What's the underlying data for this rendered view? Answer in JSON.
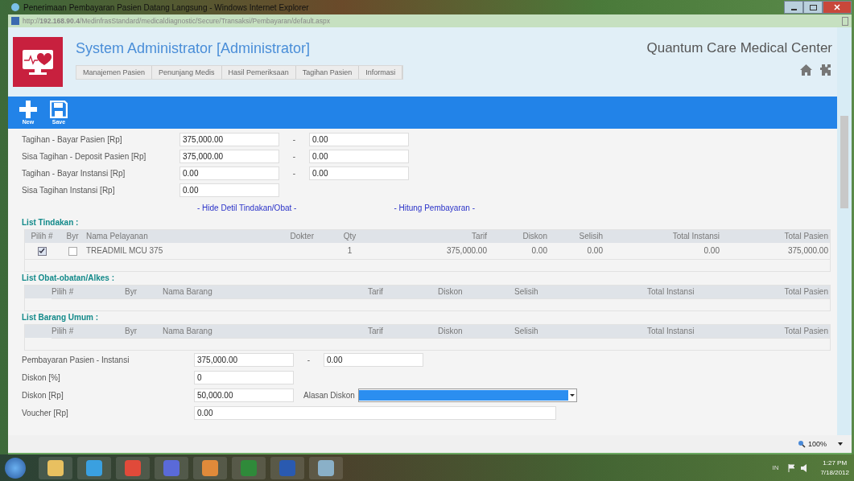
{
  "window": {
    "title": "Penerimaan Pembayaran Pasien Datang Langsung - Windows Internet Explorer"
  },
  "address_bar": {
    "url": "http://**192.168.90.4**/MedinfrasStandard/medicaldiagnostic/Secure/Transaksi/Pembayaran/default.aspx"
  },
  "header": {
    "user_title": "System Administrator [Administrator]",
    "hospital_name": "Quantum Care Medical Center",
    "menu": [
      "Manajemen Pasien",
      "Penunjang Medis",
      "Hasil Pemeriksaan",
      "Tagihan Pasien",
      "Informasi"
    ]
  },
  "toolbar": [
    {
      "kind": "new",
      "label": "New"
    },
    {
      "kind": "save",
      "label": "Save"
    }
  ],
  "payment_fields": [
    {
      "label": "Tagihan - Bayar Pasien [Rp]",
      "value": "375,000.00",
      "separator": "-",
      "value_2": "0.00"
    },
    {
      "label": "Sisa Tagihan - Deposit Pasien [Rp]",
      "value": "375,000.00",
      "separator": "-",
      "value_2": "0.00"
    },
    {
      "label": "Tagihan - Bayar Instansi [Rp]",
      "value": "0.00",
      "separator": "-",
      "value_2": "0.00"
    },
    {
      "label": "Sisa Tagihan Instansi [Rp]",
      "value": "0.00"
    }
  ],
  "links": [
    "- Hide Detil Tindakan/Obat -",
    "- Hitung Pembayaran -"
  ],
  "tables": [
    {
      "kind": "tindakan",
      "title": "List Tindakan :",
      "columns": [
        "Pilih #",
        "Byr",
        "Nama Pelayanan",
        "Dokter",
        "Qty",
        "Tarif",
        "Diskon",
        "Selisih",
        "Total Instansi",
        "Total Pasien"
      ],
      "rows": [
        {
          "pilih": true,
          "byr": false,
          "cells": [
            "",
            "",
            "TREADMIL MCU 375",
            "",
            "1",
            "375,000.00",
            "0.00",
            "0.00",
            "0.00",
            "375,000.00"
          ]
        }
      ]
    },
    {
      "kind": "barang",
      "title": "List Obat-obatan/Alkes :",
      "columns": [
        "Pilih #",
        "Byr",
        "Nama Barang",
        "Tarif",
        "Diskon",
        "Selisih",
        "Total Instansi",
        "Total Pasien"
      ]
    },
    {
      "kind": "barang",
      "title": "List Barang Umum :",
      "columns": [
        "Pilih #",
        "Byr",
        "Nama Barang",
        "Tarif",
        "Diskon",
        "Selisih",
        "Total Instansi",
        "Total Pasien"
      ]
    }
  ],
  "summary_fields": [
    {
      "kind": "pair",
      "label": "Pembayaran Pasien - Instansi",
      "value": "375,000.00",
      "separator": "-",
      "value_2": "0.00"
    },
    {
      "kind": "single",
      "label": "Diskon [%]",
      "value": "0"
    },
    {
      "kind": "select",
      "label": "Diskon [Rp]",
      "value": "50,000.00",
      "select_label": "Alasan Diskon"
    },
    {
      "kind": "wide",
      "label": "Voucher [Rp]",
      "value": "0.00"
    }
  ],
  "status_bar": {
    "zoom": "100%"
  },
  "taskbar": {
    "language": "IN",
    "time": "1:27 PM",
    "date": "7/18/2012"
  }
}
